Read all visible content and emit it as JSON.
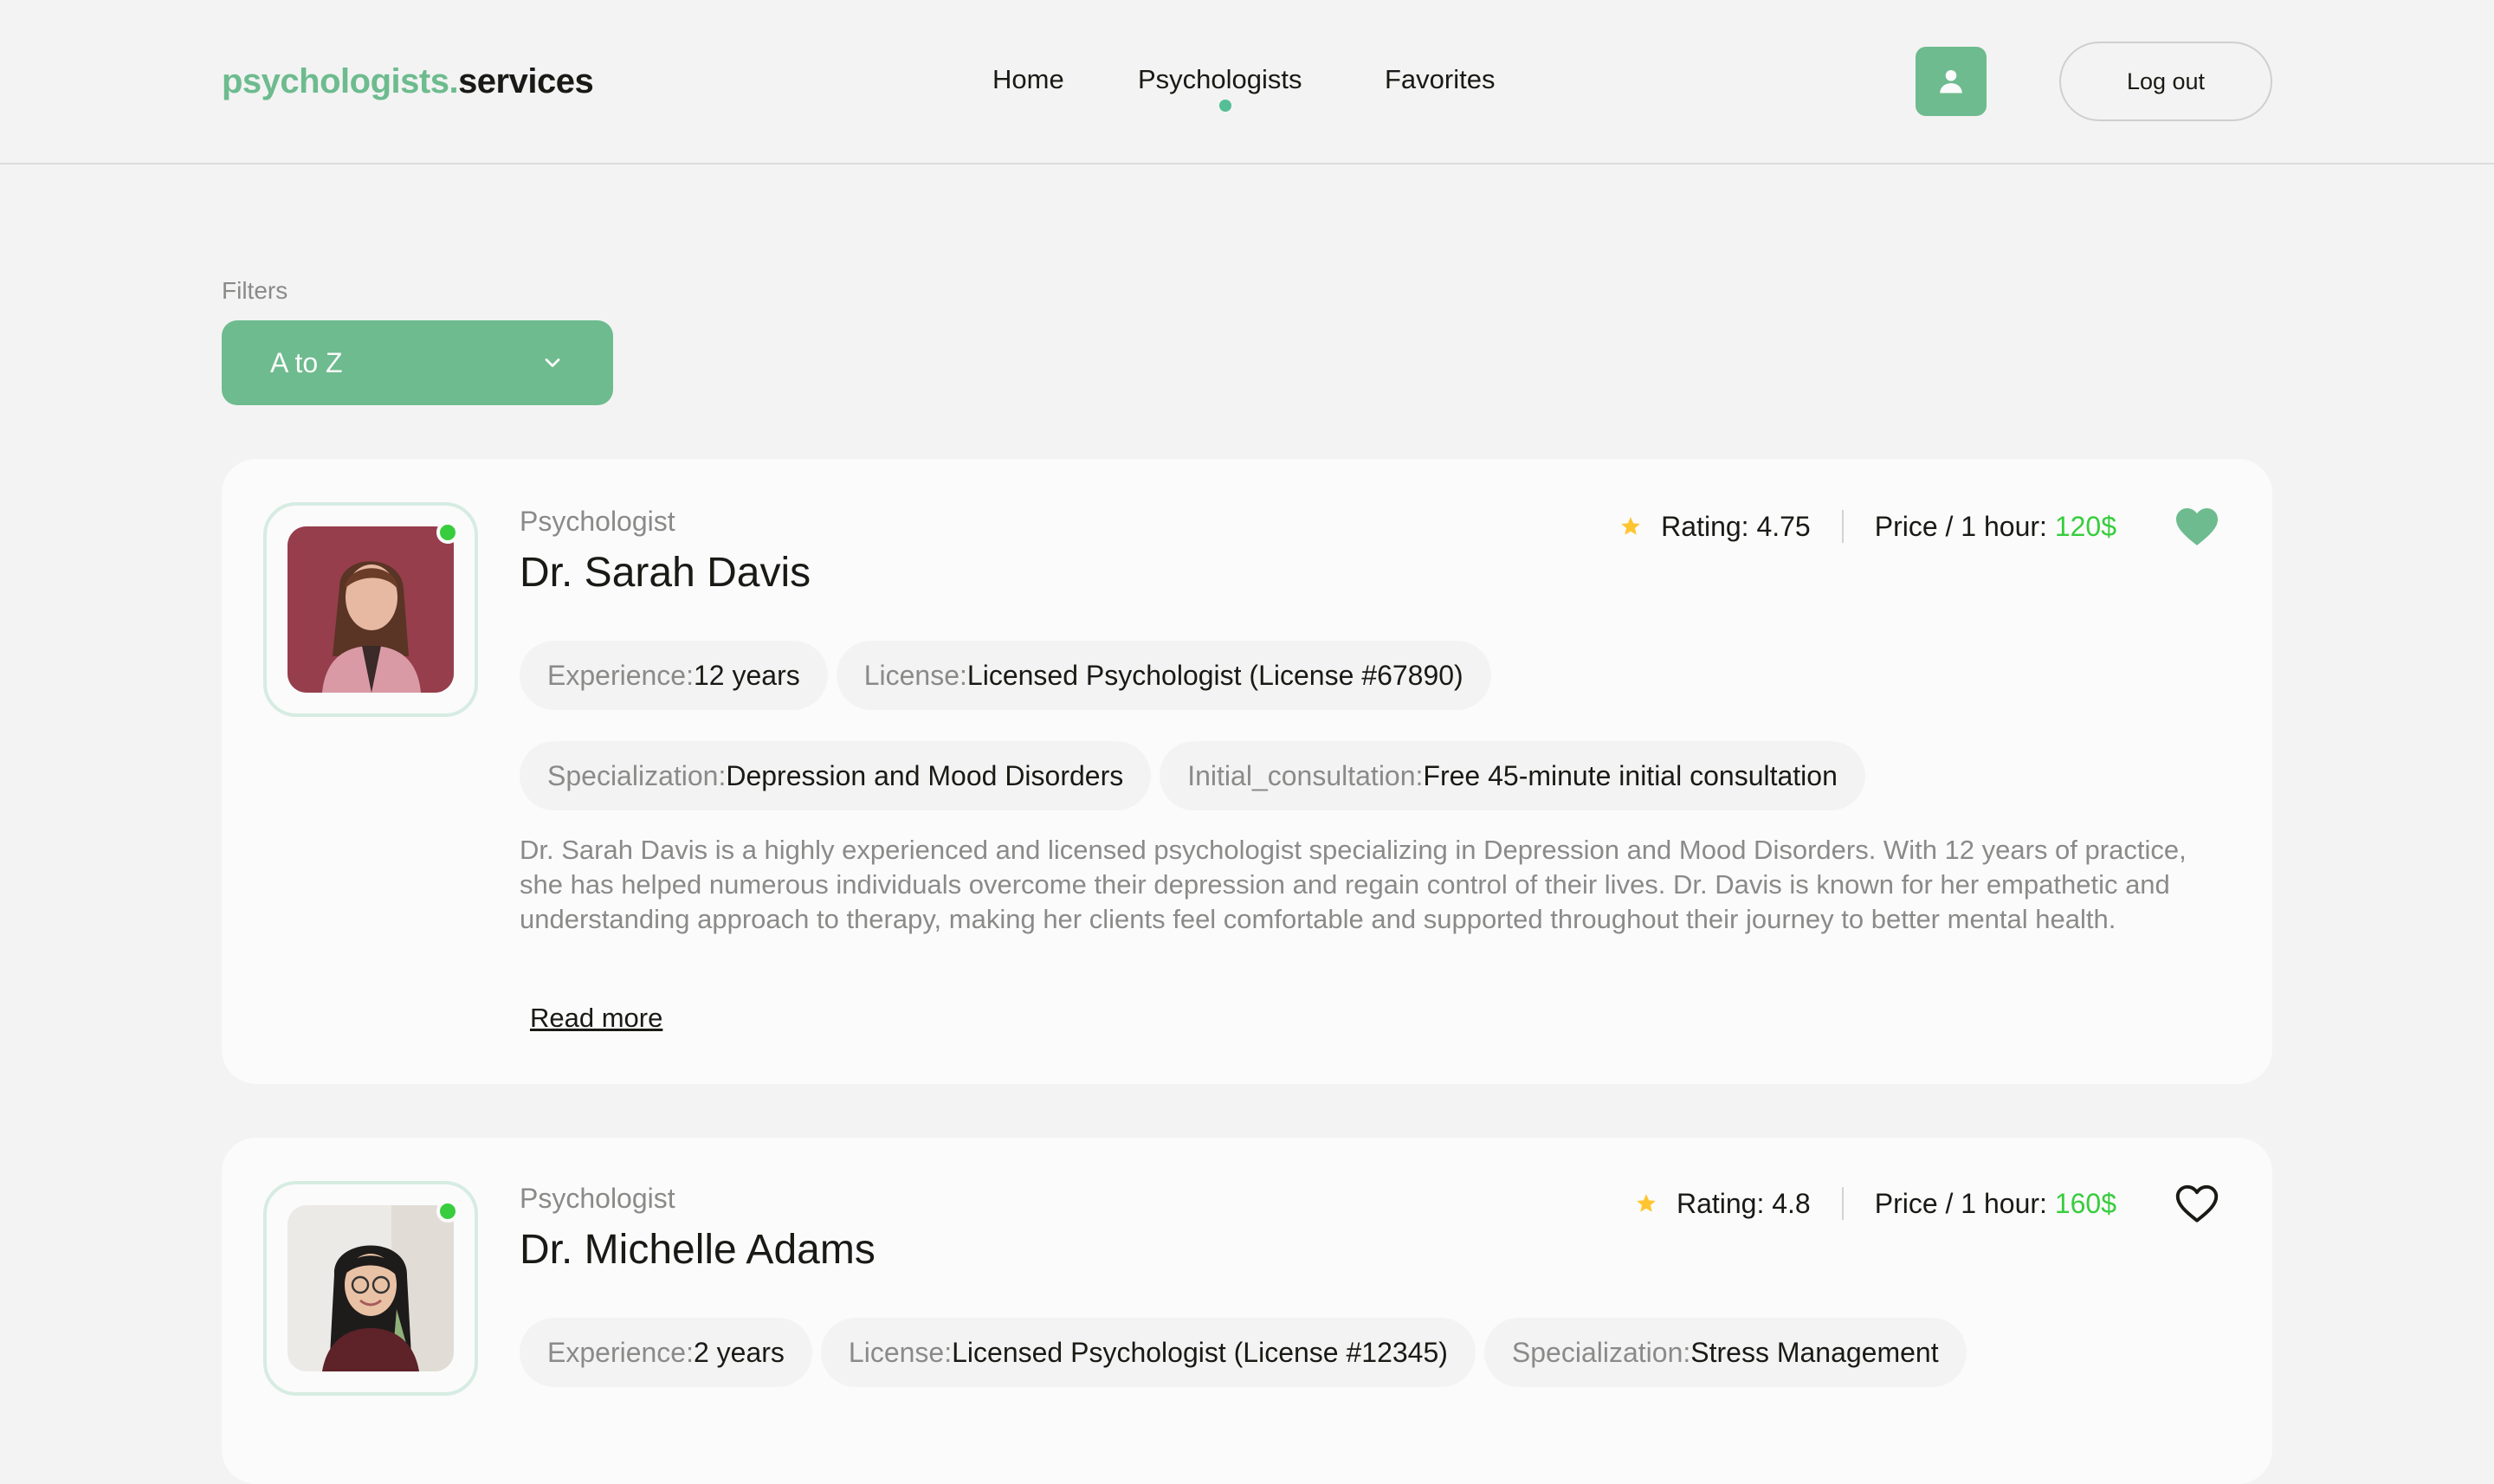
{
  "header": {
    "logo_accent": "psychologists.",
    "logo_rest": "services",
    "nav": [
      {
        "label": "Home",
        "active": false
      },
      {
        "label": "Psychologists",
        "active": true
      },
      {
        "label": "Favorites",
        "active": false
      }
    ],
    "user_icon": "user-icon",
    "logout_label": "Log out"
  },
  "filters": {
    "label": "Filters",
    "selected": "A to Z"
  },
  "colors": {
    "accent": "#6dbb8e",
    "price": "#38cd3e",
    "star": "#ffc531",
    "online": "#38cd3e"
  },
  "psychologists": [
    {
      "role": "Psychologist",
      "name": "Dr. Sarah Davis",
      "rating_label": "Rating: 4.75",
      "price_label": "Price / 1 hour: ",
      "price_value": "120$",
      "favorite": true,
      "online": true,
      "chips": [
        {
          "k": "Experience: ",
          "v": "12 years"
        },
        {
          "k": "License: ",
          "v": "Licensed Psychologist (License #67890)"
        },
        {
          "k": "Specialization: ",
          "v": "Depression and Mood Disorders"
        },
        {
          "k": "Initial_consultation: ",
          "v": "Free 45-minute initial consultation"
        }
      ],
      "description": "Dr. Sarah Davis is a highly experienced and licensed psychologist specializing in Depression and Mood Disorders. With 12 years of practice, she has helped numerous individuals overcome their depression and regain control of their lives. Dr. Davis is known for her empathetic and understanding approach to therapy, making her clients feel comfortable and supported throughout their journey to better mental health.",
      "read_more": "Read more"
    },
    {
      "role": "Psychologist",
      "name": "Dr. Michelle Adams",
      "rating_label": "Rating: 4.8",
      "price_label": "Price / 1 hour: ",
      "price_value": "160$",
      "favorite": false,
      "online": true,
      "chips": [
        {
          "k": "Experience: ",
          "v": "2 years"
        },
        {
          "k": "License: ",
          "v": "Licensed Psychologist (License #12345)"
        },
        {
          "k": "Specialization: ",
          "v": "Stress Management"
        }
      ]
    }
  ]
}
